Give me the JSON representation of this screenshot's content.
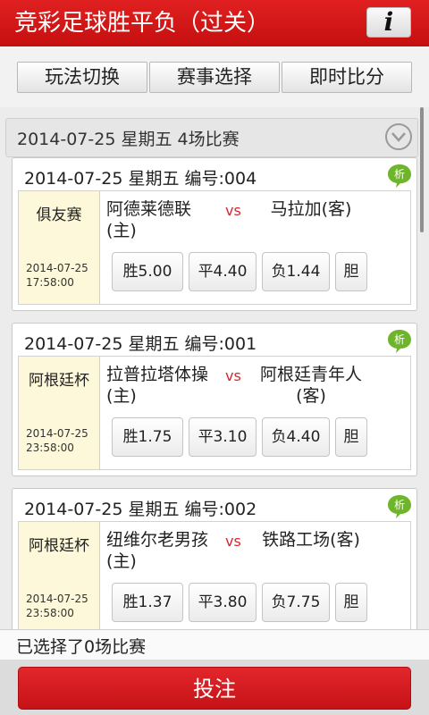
{
  "header": {
    "title": "竞彩足球胜平负（过关）",
    "info_label": "i"
  },
  "tabs": [
    "玩法切换",
    "赛事选择",
    "即时比分"
  ],
  "date_header": {
    "label": "2014-07-25  星期五  4场比赛"
  },
  "matches": [
    {
      "title": "2014-07-25  星期五  编号:004",
      "badge": "析",
      "league": "俱友赛",
      "date": "2014-07-25",
      "time": "17:58:00",
      "home": "阿德莱德联(主)",
      "vs": "vs",
      "away": "马拉加(客)",
      "win": "胜5.00",
      "draw": "平4.40",
      "lose": "负1.44",
      "dan": "胆"
    },
    {
      "title": "2014-07-25  星期五  编号:001",
      "badge": "析",
      "league": "阿根廷杯",
      "date": "2014-07-25",
      "time": "23:58:00",
      "home": "拉普拉塔体操(主)",
      "vs": "vs",
      "away": "阿根廷青年人(客)",
      "win": "胜1.75",
      "draw": "平3.10",
      "lose": "负4.40",
      "dan": "胆"
    },
    {
      "title": "2014-07-25  星期五  编号:002",
      "badge": "析",
      "league": "阿根廷杯",
      "date": "2014-07-25",
      "time": "23:58:00",
      "home": "纽维尔老男孩(主)",
      "vs": "vs",
      "away": "铁路工场(客)",
      "win": "胜1.37",
      "draw": "平3.80",
      "lose": "负7.75",
      "dan": "胆"
    }
  ],
  "status": {
    "selected_text": "已选择了0场比赛"
  },
  "submit": {
    "label": "投注"
  },
  "colors": {
    "brand_red": "#d01a1f",
    "badge_green": "#6fb52c",
    "league_bg": "#fdf8d9"
  },
  "icons": {
    "info": "info-icon",
    "expand": "chevron-down-icon",
    "analysis": "analysis-badge-icon"
  }
}
